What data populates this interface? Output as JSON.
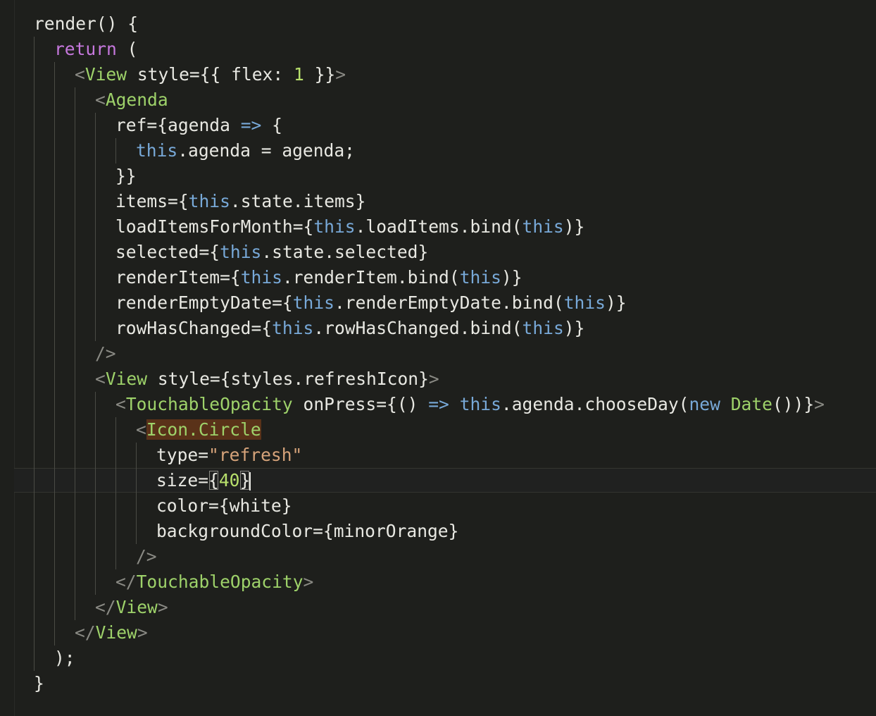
{
  "code_lines": [
    "render() {",
    "  return (",
    "    <View style={{ flex: 1 }}>",
    "      <Agenda",
    "        ref={agenda => {",
    "          this.agenda = agenda;",
    "        }}",
    "        items={this.state.items}",
    "        loadItemsForMonth={this.loadItems.bind(this)}",
    "        selected={this.state.selected}",
    "        renderItem={this.renderItem.bind(this)}",
    "        renderEmptyDate={this.renderEmptyDate.bind(this)}",
    "        rowHasChanged={this.rowHasChanged.bind(this)}",
    "      />",
    "      <View style={styles.refreshIcon}>",
    "        <TouchableOpacity onPress={() => this.agenda.chooseDay(new Date())}>",
    "          <Icon.Circle",
    "            type=\"refresh\"",
    "            size={40}",
    "            color={white}",
    "            backgroundColor={minorOrange}",
    "          />",
    "        </TouchableOpacity>",
    "      </View>",
    "    </View>",
    "  );",
    "}"
  ],
  "tokens": {
    "render": "render",
    "return": "return",
    "view": "View",
    "style": "style",
    "flex": "flex",
    "one": "1",
    "agenda_tag": "Agenda",
    "ref": "ref",
    "agenda_param": "agenda",
    "arrow": "=>",
    "this": "this",
    "agenda_prop": "agenda",
    "items_attr": "items",
    "state": "state",
    "items": "items",
    "load_attr": "loadItemsForMonth",
    "load_items": "loadItems",
    "bind": "bind",
    "selected_attr": "selected",
    "selected": "selected",
    "render_item_attr": "renderItem",
    "render_item": "renderItem",
    "render_empty_attr": "renderEmptyDate",
    "render_empty": "renderEmptyDate",
    "row_changed_attr": "rowHasChanged",
    "row_changed": "rowHasChanged",
    "styles": "styles",
    "refresh_icon": "refreshIcon",
    "touchable": "TouchableOpacity",
    "on_press": "onPress",
    "choose_day": "chooseDay",
    "new": "new",
    "date": "Date",
    "icon_circle": "Icon.Circle",
    "type_attr": "type",
    "type_val": "\"refresh\"",
    "size_attr": "size",
    "size_val": "40",
    "color_attr": "color",
    "white": "white",
    "bg_attr": "backgroundColor",
    "minor_orange": "minorOrange"
  },
  "colors": {
    "background": "#1e1f1c",
    "plain": "#e8e8e2",
    "keyword": "#c678dd",
    "entity": "#9ed26a",
    "tag_bracket": "#8a8a84",
    "this_keyword": "#78a9d8",
    "string": "#d6a37a",
    "highlight_bg": "#5a3219"
  },
  "current_line": 19
}
